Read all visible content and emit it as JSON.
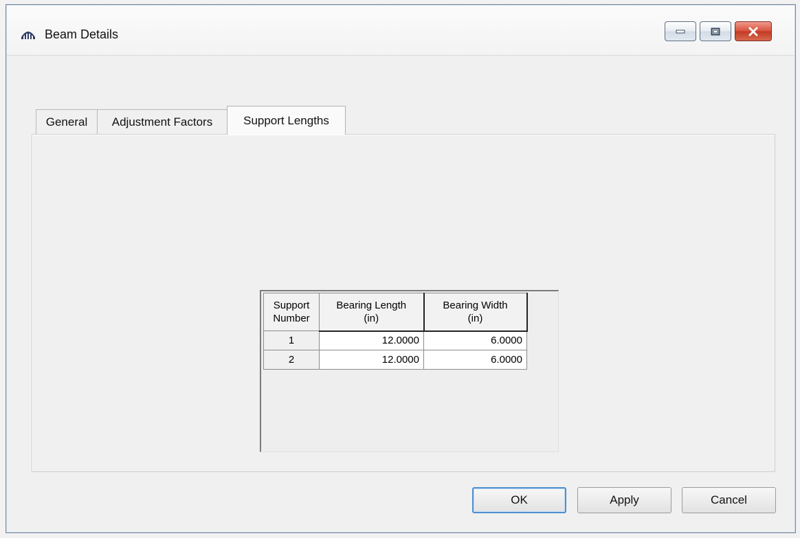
{
  "window": {
    "title": "Beam Details",
    "icon": "bridge-icon"
  },
  "tabs": [
    {
      "label": "General"
    },
    {
      "label": "Adjustment Factors"
    },
    {
      "label": "Support Lengths",
      "active": true
    }
  ],
  "grid": {
    "headers": {
      "support_number_line1": "Support",
      "support_number_line2": "Number",
      "bearing_length_line1": "Bearing Length",
      "bearing_length_line2": "(in)",
      "bearing_width_line1": "Bearing Width",
      "bearing_width_line2": "(in)"
    },
    "rows": [
      {
        "support": "1",
        "bearing_length": "12.0000",
        "bearing_width": "6.0000"
      },
      {
        "support": "2",
        "bearing_length": "12.0000",
        "bearing_width": "6.0000"
      }
    ]
  },
  "buttons": {
    "ok": "OK",
    "apply": "Apply",
    "cancel": "Cancel"
  },
  "colors": {
    "close_button": "#d9533f",
    "ok_focus_border": "#4d8fd0"
  }
}
